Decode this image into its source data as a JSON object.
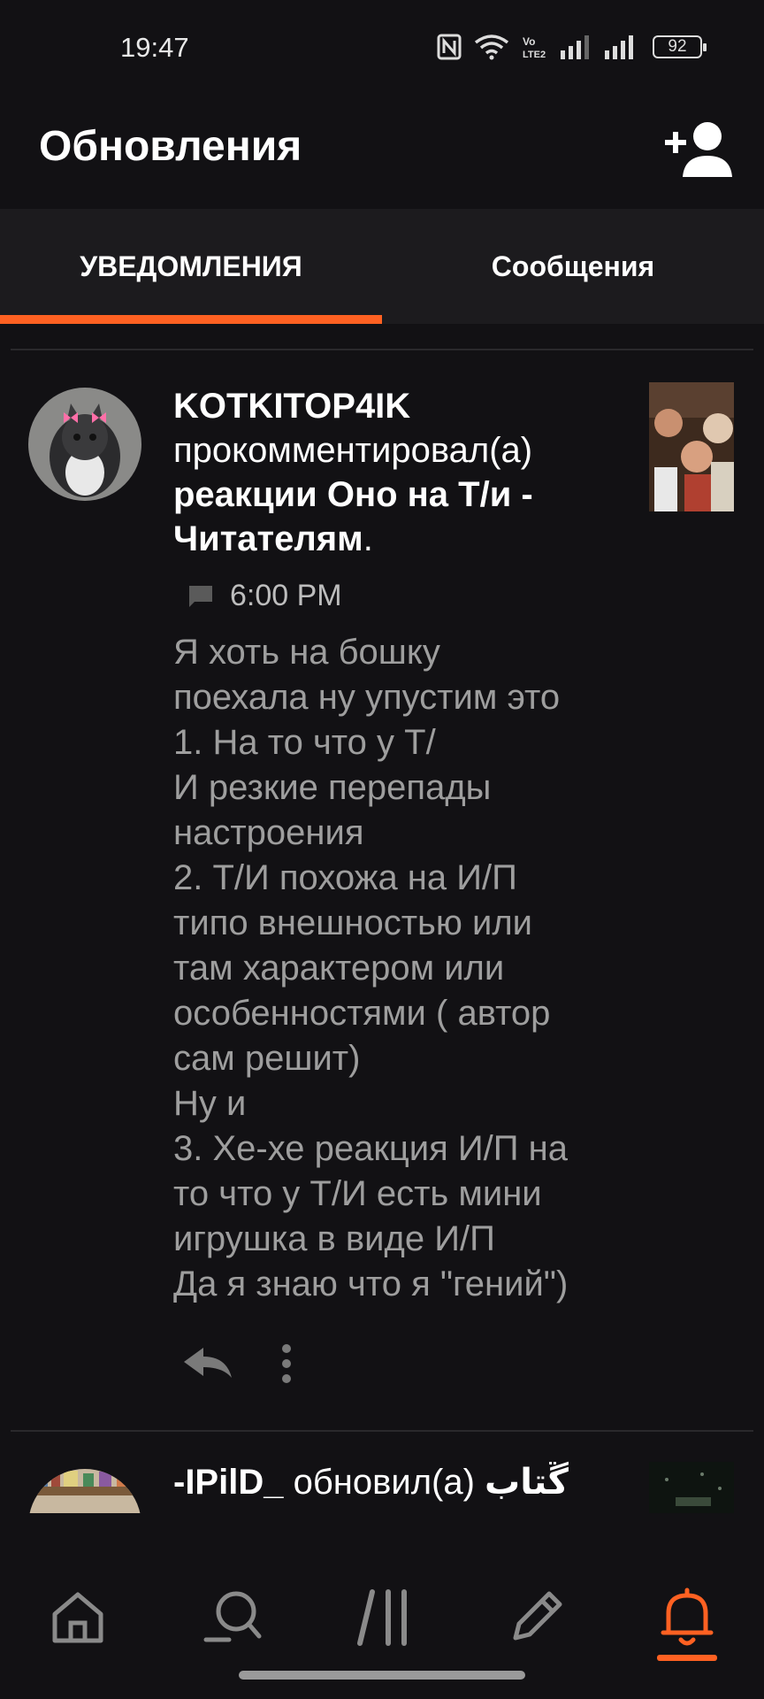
{
  "status_bar": {
    "time": "19:47",
    "battery": "92"
  },
  "header": {
    "title": "Обновления",
    "add_user_icon": "add-user-icon"
  },
  "tabs": [
    {
      "label": "УВЕДОМЛЕНИЯ",
      "active": true
    },
    {
      "label": "Сообщения",
      "active": false
    }
  ],
  "notifications": [
    {
      "user": "KOTKITOP4IK",
      "action": "прокомментировал(а)",
      "story": "реакции Оно на Т/и - Читателям",
      "suffix": ".",
      "time": "6:00 PM",
      "comment": "Я хоть на бошку\nпоехала ну упустим это\n1. На то что у Т/\nИ резкие перепады\nнастроения\n2. Т/И похожа на И/П\nтипо внешностью или\nтам характером или\nособенностями ( автор\nсам решит)\nНу и\n3. Хе-хе реакция И/П на\nто что у Т/И есть мини\nигрушка в виде И/П\nДа я знаю что я \"гений\")"
    },
    {
      "user": "-IPilD_",
      "action": "обновил(а)",
      "story": "ڱتاب"
    }
  ],
  "bottom_nav": [
    {
      "name": "home",
      "icon": "home-icon"
    },
    {
      "name": "search",
      "icon": "search-icon"
    },
    {
      "name": "library",
      "icon": "library-icon"
    },
    {
      "name": "write",
      "icon": "pencil-icon"
    },
    {
      "name": "notifications",
      "icon": "bell-icon",
      "active": true
    }
  ],
  "colors": {
    "accent": "#ff6122",
    "background": "#121114",
    "tab_bg": "#1c1b1e"
  }
}
